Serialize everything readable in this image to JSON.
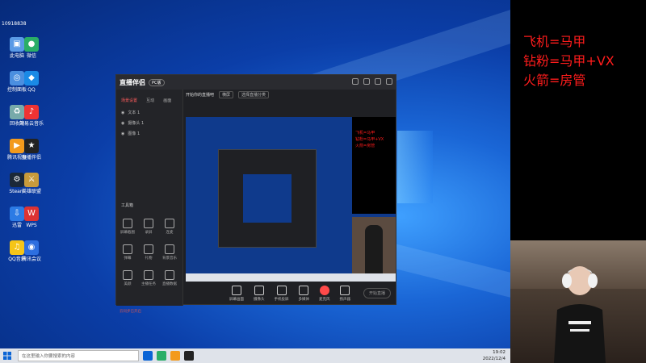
{
  "desktop": {
    "top_left_label": "10918838",
    "icons": [
      {
        "label": "此电脑",
        "color": "#5a9ae6"
      },
      {
        "label": "网易云音乐",
        "color": "#e33"
      },
      {
        "label": "回收站",
        "color": "#7aa"
      },
      {
        "label": "微信",
        "color": "#2aae67"
      },
      {
        "label": "控制面板",
        "color": "#4b8fe0"
      },
      {
        "label": "QQ",
        "color": "#1a8ae6"
      },
      {
        "label": "腾讯视频",
        "color": "#f39a1c"
      },
      {
        "label": "直播伴侣",
        "color": "#222"
      },
      {
        "label": "Steam",
        "color": "#1b2838"
      },
      {
        "label": "英雄联盟",
        "color": "#c89b3c"
      },
      {
        "label": "迅雷",
        "color": "#2c7be5"
      },
      {
        "label": "WPS",
        "color": "#d33"
      },
      {
        "label": "QQ音乐",
        "color": "#f5c518"
      },
      {
        "label": "腾讯会议",
        "color": "#2d6fe0"
      }
    ]
  },
  "taskbar": {
    "search_placeholder": "在这里输入你要搜索的内容",
    "time": "19:02",
    "date": "2022/12/4"
  },
  "overlay": {
    "line1": "飞机=马甲",
    "line2": "钻粉=马甲+VX",
    "line3": "火箭=房管",
    "color": "#ff1c1c"
  },
  "app": {
    "title": "直播伴侣",
    "badge": "PC版",
    "sidebar_tabs": [
      "场景设置",
      "互动",
      "画面"
    ],
    "scenes": [
      "文本 1",
      "摄像头 1",
      "图像 1"
    ],
    "tools_title": "工具箱",
    "tools": [
      "屏幕截图",
      "录屏",
      "连麦",
      "弹幕",
      "礼物",
      "背景音乐",
      "美颜",
      "主播任务",
      "直播数据"
    ],
    "footer_message": "云同步已开启",
    "topbar": {
      "title": "开始你的直播吧",
      "tag": "横屏",
      "category": "选择直播分类"
    },
    "controls": [
      "屏幕画面",
      "摄像头",
      "手机投屏",
      "多媒体",
      "麦克风",
      "扬声器"
    ],
    "start_button": "开始直播"
  }
}
